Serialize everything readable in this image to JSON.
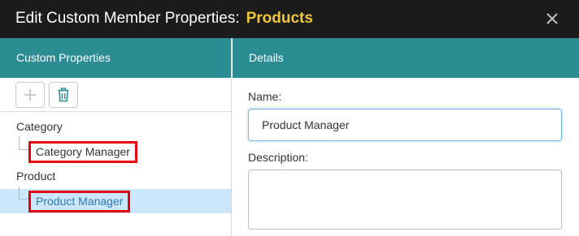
{
  "dialog": {
    "title": "Edit Custom Member Properties:",
    "title_accent": "Products",
    "close_icon": "close-icon"
  },
  "left_pane": {
    "header": "Custom Properties",
    "toolbar": {
      "add_icon": "plus-icon",
      "delete_icon": "trash-icon"
    },
    "tree": [
      {
        "group": "Category",
        "children": [
          {
            "label": "Category Manager",
            "selected": false
          }
        ]
      },
      {
        "group": "Product",
        "children": [
          {
            "label": "Product Manager",
            "selected": true
          }
        ]
      }
    ]
  },
  "right_pane": {
    "header": "Details",
    "name_label": "Name:",
    "name_value": "Product Manager",
    "description_label": "Description:",
    "description_value": ""
  },
  "colors": {
    "titlebar": "#1c1c1c",
    "title_accent": "#f0c73a",
    "pane_header": "#2b8d93",
    "selected_row": "#cce6fb",
    "highlight_box": "#e3000f"
  }
}
